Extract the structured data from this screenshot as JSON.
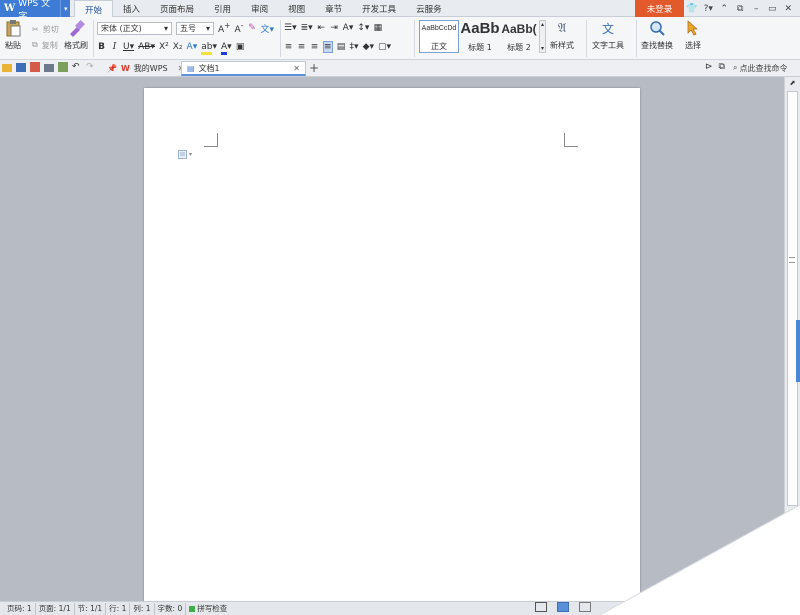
{
  "app": {
    "name": "WPS 文字",
    "login_label": "未登录"
  },
  "menu": {
    "tabs": [
      "开始",
      "插入",
      "页面布局",
      "引用",
      "审阅",
      "视图",
      "章节",
      "开发工具",
      "云服务"
    ]
  },
  "ribbon": {
    "paste": "粘贴",
    "cut": "剪切",
    "copy": "复制",
    "format_painter": "格式刷",
    "font_name": "宋体 (正文)",
    "font_size": "五号",
    "styles": [
      {
        "sample": "AaBbCcDd",
        "label": "正文"
      },
      {
        "sample": "AaBb",
        "label": "标题 1"
      },
      {
        "sample": "AaBb(",
        "label": "标题 2"
      }
    ],
    "new_style": "新样式",
    "text_tools": "文字工具",
    "find_replace": "查找替换",
    "select": "选择"
  },
  "tabs": {
    "wps_tab": "我的WPS",
    "doc_tab": "文档1",
    "find_command": "点此查找命令"
  },
  "status": {
    "page_no": "页码: 1",
    "pages": "页面: 1/1",
    "section": "节: 1/1",
    "row": "行: 1",
    "col": "列: 1",
    "words": "字数: 0",
    "spell_check": "拼写检查"
  },
  "colors": {
    "accent": "#3d7bd5",
    "login": "#e2592b",
    "font_color": "#1f3fd1",
    "highlight": "#f3e03a"
  }
}
